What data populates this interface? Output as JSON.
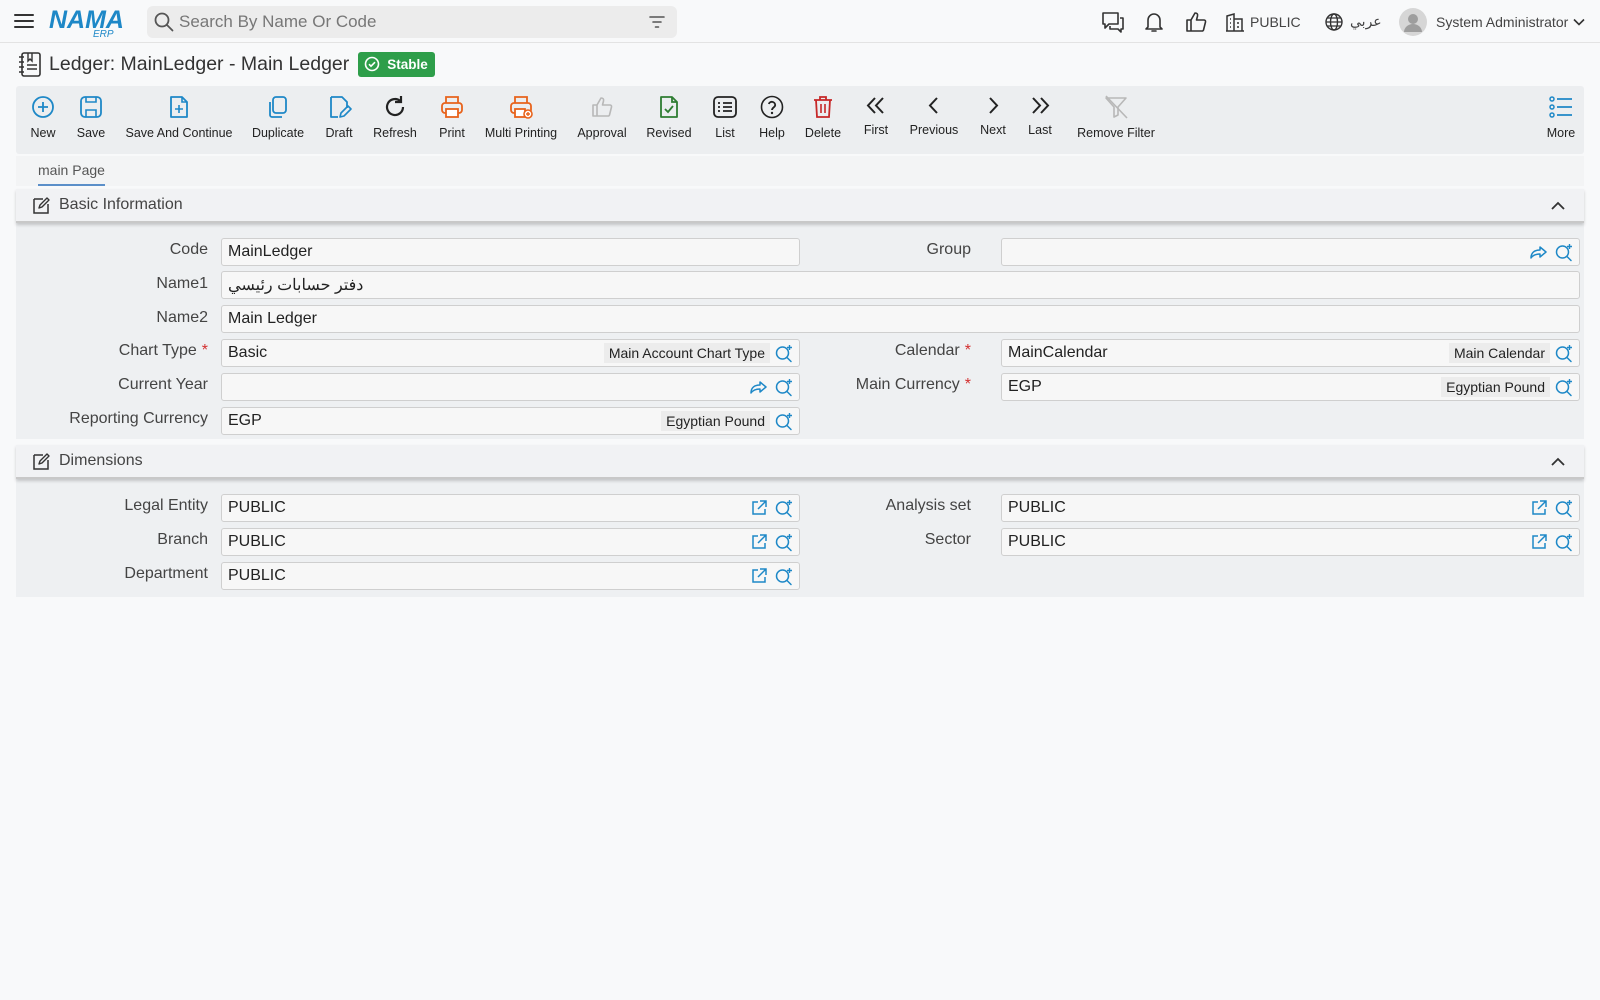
{
  "header": {
    "logo_text": "NAMA",
    "logo_sub": "ERP",
    "search_placeholder": "Search By Name Or Code",
    "company": "PUBLIC",
    "language": "عربي",
    "user": "System Administrator"
  },
  "page": {
    "title": "Ledger: MainLedger - Main Ledger",
    "status": "Stable"
  },
  "toolbar": {
    "new": "New",
    "save": "Save",
    "save_continue": "Save And Continue",
    "duplicate": "Duplicate",
    "draft": "Draft",
    "refresh": "Refresh",
    "print": "Print",
    "multi_printing": "Multi Printing",
    "approval": "Approval",
    "revised": "Revised",
    "list": "List",
    "help": "Help",
    "delete": "Delete",
    "first": "First",
    "previous": "Previous",
    "next": "Next",
    "last": "Last",
    "remove_filter": "Remove Filter",
    "more": "More"
  },
  "tabs": [
    "main Page"
  ],
  "basic": {
    "title": "Basic Information",
    "code": {
      "label": "Code",
      "value": "MainLedger"
    },
    "group": {
      "label": "Group",
      "value": ""
    },
    "name1": {
      "label": "Name1",
      "value": "دفتر حسابات رئيسي"
    },
    "name2": {
      "label": "Name2",
      "value": "Main Ledger"
    },
    "chart_type": {
      "label": "Chart Type",
      "value": "Basic",
      "desc": "Main Account Chart Type"
    },
    "calendar": {
      "label": "Calendar",
      "value": "MainCalendar",
      "desc": "Main Calendar"
    },
    "current_year": {
      "label": "Current Year",
      "value": ""
    },
    "main_currency": {
      "label": "Main Currency",
      "value": "EGP",
      "desc": "Egyptian Pound"
    },
    "reporting_currency": {
      "label": "Reporting Currency",
      "value": "EGP",
      "desc": "Egyptian Pound"
    }
  },
  "dimensions": {
    "title": "Dimensions",
    "legal_entity": {
      "label": "Legal Entity",
      "value": "PUBLIC"
    },
    "analysis_set": {
      "label": "Analysis set",
      "value": "PUBLIC"
    },
    "branch": {
      "label": "Branch",
      "value": "PUBLIC"
    },
    "sector": {
      "label": "Sector",
      "value": "PUBLIC"
    },
    "department": {
      "label": "Department",
      "value": "PUBLIC"
    }
  },
  "required_mark": "*",
  "colors": {
    "accent": "#1e88c7",
    "print": "#e8631c",
    "success": "#2e9e4a",
    "danger": "#c62828",
    "required": "#d32f2f"
  }
}
